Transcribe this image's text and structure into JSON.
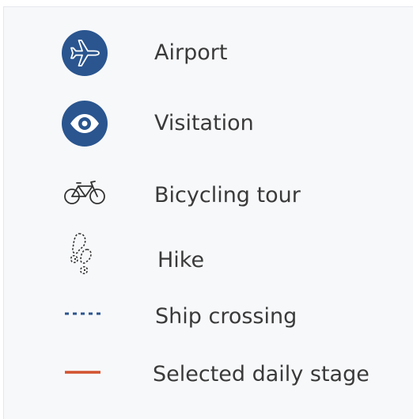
{
  "legend": {
    "items": [
      {
        "icon": "airplane-icon",
        "label": "Airport"
      },
      {
        "icon": "eye-icon",
        "label": "Visitation"
      },
      {
        "icon": "bicycle-icon",
        "label": "Bicycling tour"
      },
      {
        "icon": "footprints-icon",
        "label": "Hike"
      },
      {
        "icon": "dotted-line-icon",
        "label": "Ship crossing"
      },
      {
        "icon": "solid-line-icon",
        "label": "Selected daily stage"
      }
    ]
  },
  "colors": {
    "badge": "#2a558f",
    "ship_line": "#2a558f",
    "stage_line": "#d2522e",
    "text": "#3a3a3a",
    "icon_outline": "#333333",
    "panel_bg": "#f7f8fa"
  }
}
